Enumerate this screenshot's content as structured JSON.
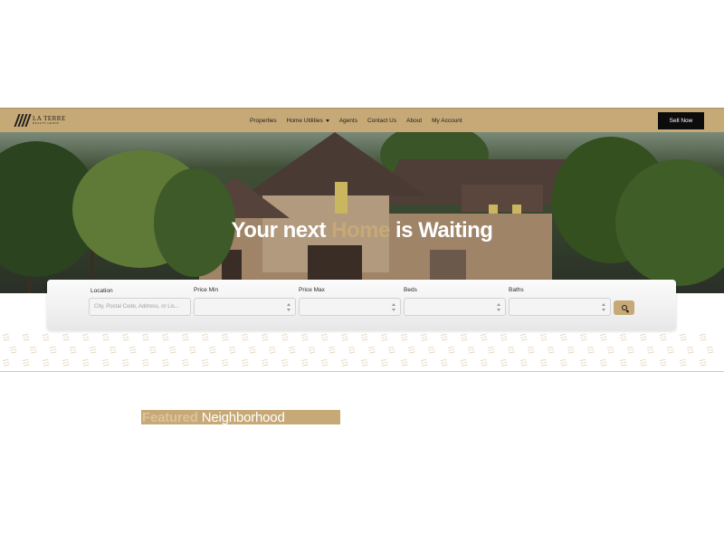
{
  "brand": {
    "logo_name": "LA TERRE",
    "logo_sub": "REALTY GROUP",
    "accent": "#c6a976",
    "dark": "#0c0c0c"
  },
  "nav": {
    "items": [
      {
        "label": "Properties"
      },
      {
        "label": "Home Utilities",
        "has_dropdown": true
      },
      {
        "label": "Agents"
      },
      {
        "label": "Contact Us"
      },
      {
        "label": "About"
      },
      {
        "label": "My Account"
      }
    ],
    "cta_label": "Sell Now"
  },
  "hero": {
    "title_pre": "Your next",
    "title_accent": "Home",
    "title_post": "is Waiting"
  },
  "search": {
    "location_label": "Location",
    "location_placeholder": "City, Postal Code, Address, or Lis...",
    "price_min_label": "Price Min",
    "price_max_label": "Price Max",
    "beds_label": "Beds",
    "baths_label": "Baths",
    "button_icon": "search-icon"
  },
  "featured": {
    "word1": "Featured",
    "word2": "Neighborhood"
  }
}
